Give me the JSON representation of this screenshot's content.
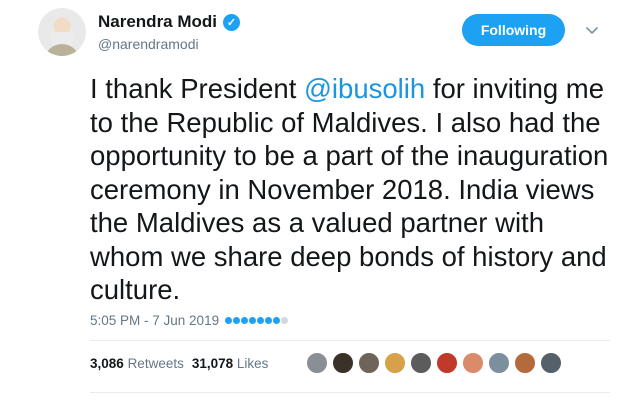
{
  "author": {
    "name": "Narendra Modi",
    "handle": "@narendramodi",
    "verified": true
  },
  "follow_button": {
    "label": "Following"
  },
  "tweet": {
    "text_before": "I thank President ",
    "mention": "@ibusolih",
    "text_after": " for inviting me to the Republic of Maldives. I also had the opportunity to be a part of the inauguration ceremony in November 2018. India views the Maldives as a valued partner with whom we share deep bonds of history and culture."
  },
  "timestamp": "5:05 PM - 7 Jun 2019",
  "stats": {
    "retweets_count": "3,086",
    "retweets_label": "Retweets",
    "likes_count": "31,078",
    "likes_label": "Likes"
  },
  "likers": [
    {
      "color": "#8a8f96"
    },
    {
      "color": "#3a3129"
    },
    {
      "color": "#6f6459"
    },
    {
      "color": "#d7a14a"
    },
    {
      "color": "#5c5c5c"
    },
    {
      "color": "#c0392b"
    },
    {
      "color": "#d98b6a"
    },
    {
      "color": "#7b8f9c"
    },
    {
      "color": "#b46b3b"
    },
    {
      "color": "#55606a"
    }
  ],
  "colors": {
    "accent": "#1da1f2",
    "mention": "#1b95e0",
    "muted": "#657786"
  }
}
